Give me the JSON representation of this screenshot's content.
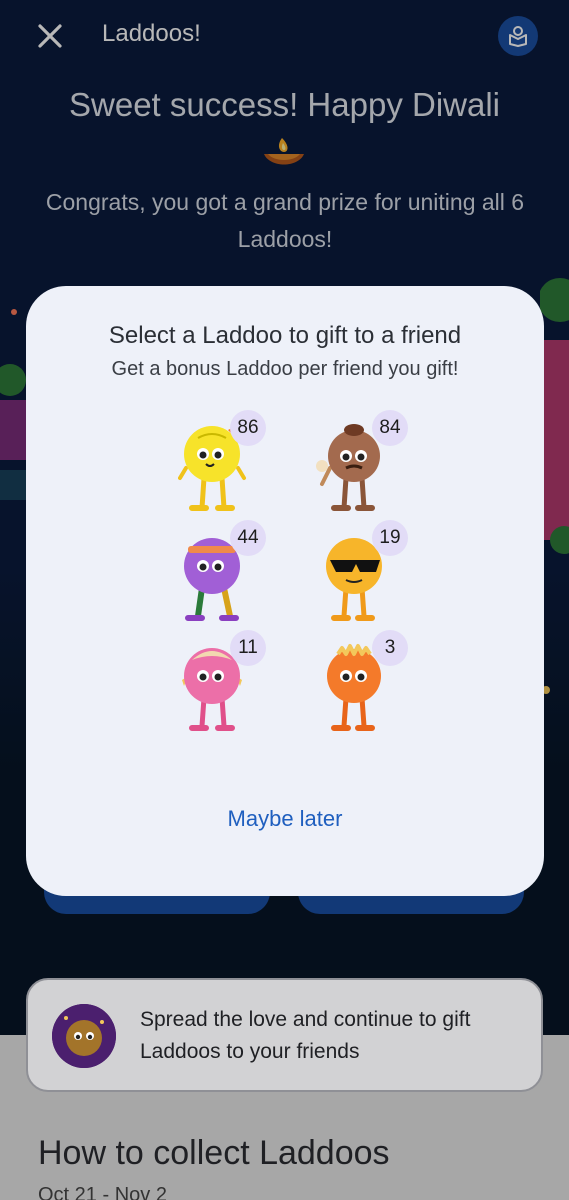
{
  "header": {
    "title": "Laddoos!",
    "close_icon": "close-icon",
    "profile_icon": "laddoo-box-icon"
  },
  "hero": {
    "headline": "Sweet success! Happy Diwali",
    "message": "Congrats, you got a grand prize for uniting all 6 Laddoos!"
  },
  "modal": {
    "title": "Select a Laddoo to gift to a friend",
    "subtitle": "Get a bonus Laddoo per friend you gift!",
    "laddoos": [
      {
        "name": "yellow-laddoo",
        "count": "86",
        "color": "#f7d62a"
      },
      {
        "name": "brown-laddoo",
        "count": "84",
        "color": "#a36a4e"
      },
      {
        "name": "purple-laddoo",
        "count": "44",
        "color": "#a15fd6"
      },
      {
        "name": "sunglasses-laddoo",
        "count": "19",
        "color": "#f7b52a"
      },
      {
        "name": "pink-laddoo",
        "count": "11",
        "color": "#ec6fa8"
      },
      {
        "name": "orange-laddoo",
        "count": "3",
        "color": "#f47a2a"
      }
    ],
    "maybe_later": "Maybe later"
  },
  "gift_card": {
    "text": "Spread the love and continue to gift Laddoos to your friends"
  },
  "how_to": {
    "title": "How to collect Laddoos",
    "dates": "Oct 21 - Nov 2"
  }
}
